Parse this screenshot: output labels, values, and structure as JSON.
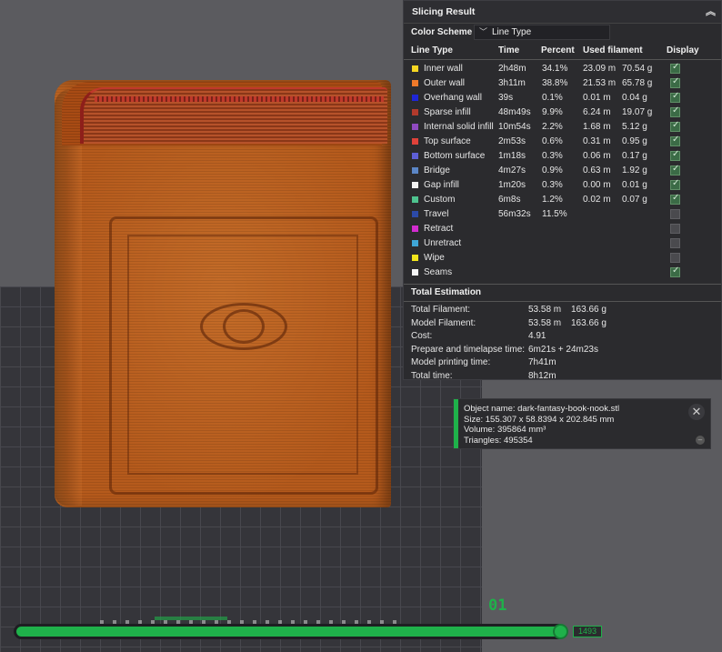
{
  "slicing_result": {
    "title": "Slicing Result",
    "color_scheme_label": "Color Scheme",
    "color_scheme_value": "Line Type",
    "headers": {
      "line_type": "Line Type",
      "time": "Time",
      "percent": "Percent",
      "used_filament": "Used filament",
      "display": "Display"
    },
    "rows": [
      {
        "name": "Inner wall",
        "color": "#f5d622",
        "time": "2h48m",
        "percent": "34.1%",
        "meters": "23.09 m",
        "grams": "70.54 g",
        "display": true
      },
      {
        "name": "Outer wall",
        "color": "#f07a2a",
        "time": "3h11m",
        "percent": "38.8%",
        "meters": "21.53 m",
        "grams": "65.78 g",
        "display": true
      },
      {
        "name": "Overhang wall",
        "color": "#1f26d6",
        "time": "39s",
        "percent": "0.1%",
        "meters": "0.01 m",
        "grams": "0.04 g",
        "display": true
      },
      {
        "name": "Sparse infill",
        "color": "#b23a2c",
        "time": "48m49s",
        "percent": "9.9%",
        "meters": "6.24 m",
        "grams": "19.07 g",
        "display": true
      },
      {
        "name": "Internal solid infill",
        "color": "#8f4ac0",
        "time": "10m54s",
        "percent": "2.2%",
        "meters": "1.68 m",
        "grams": "5.12 g",
        "display": true
      },
      {
        "name": "Top surface",
        "color": "#e0423a",
        "time": "2m53s",
        "percent": "0.6%",
        "meters": "0.31 m",
        "grams": "0.95 g",
        "display": true
      },
      {
        "name": "Bottom surface",
        "color": "#5e5fd6",
        "time": "1m18s",
        "percent": "0.3%",
        "meters": "0.06 m",
        "grams": "0.17 g",
        "display": true
      },
      {
        "name": "Bridge",
        "color": "#5b86c6",
        "time": "4m27s",
        "percent": "0.9%",
        "meters": "0.63 m",
        "grams": "1.92 g",
        "display": true
      },
      {
        "name": "Gap infill",
        "color": "#f2f2f2",
        "time": "1m20s",
        "percent": "0.3%",
        "meters": "0.00 m",
        "grams": "0.01 g",
        "display": true
      },
      {
        "name": "Custom",
        "color": "#4ec38f",
        "time": "6m8s",
        "percent": "1.2%",
        "meters": "0.02 m",
        "grams": "0.07 g",
        "display": true
      },
      {
        "name": "Travel",
        "color": "#2c4aa8",
        "time": "56m32s",
        "percent": "11.5%",
        "meters": "",
        "grams": "",
        "display": false
      },
      {
        "name": "Retract",
        "color": "#d22ccf",
        "time": "",
        "percent": "",
        "meters": "",
        "grams": "",
        "display": false
      },
      {
        "name": "Unretract",
        "color": "#3fa6d6",
        "time": "",
        "percent": "",
        "meters": "",
        "grams": "",
        "display": false
      },
      {
        "name": "Wipe",
        "color": "#f2e51c",
        "time": "",
        "percent": "",
        "meters": "",
        "grams": "",
        "display": false
      },
      {
        "name": "Seams",
        "color": "#f5f5f5",
        "time": "",
        "percent": "",
        "meters": "",
        "grams": "",
        "display": true
      }
    ]
  },
  "total_estimation": {
    "title": "Total Estimation",
    "rows": [
      {
        "label": "Total Filament:",
        "v1": "53.58 m",
        "v2": "163.66 g"
      },
      {
        "label": "Model Filament:",
        "v1": "53.58 m",
        "v2": "163.66 g"
      },
      {
        "label": "Cost:",
        "v1": "4.91",
        "v2": ""
      },
      {
        "label": "Prepare and timelapse time:",
        "v1": "6m21s + 24m23s",
        "v2": ""
      },
      {
        "label": "Model printing time:",
        "v1": "7h41m",
        "v2": ""
      },
      {
        "label": "Total time:",
        "v1": "8h12m",
        "v2": ""
      }
    ]
  },
  "object_info": {
    "name_line": "Object name: dark-fantasy-book-nook.stl",
    "size_line": "Size: 155.307 x 58.8394 x 202.845 mm",
    "volume_line": "Volume: 395864 mm³",
    "triangles_line": "Triangles: 495354"
  },
  "layer_slider": {
    "top_label": "01",
    "value": "1493",
    "position_fraction": 1.0
  },
  "colors": {
    "accent": "#1fb14a",
    "model": "#b55a1c",
    "panel_bg": "#2b2b2e"
  }
}
